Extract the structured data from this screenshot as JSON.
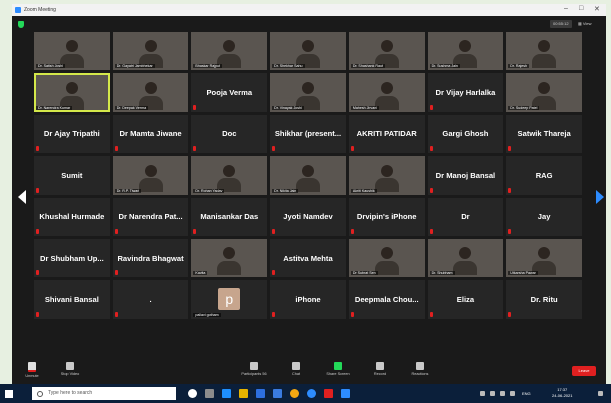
{
  "window": {
    "title": "Zoom Meeting",
    "minimize": "–",
    "maximize": "□",
    "close": "✕"
  },
  "header": {
    "elapsed": "00:55:12",
    "view_label": "View"
  },
  "tiles": [
    {
      "kind": "video",
      "name": "Dr. Satish Joshi"
    },
    {
      "kind": "video",
      "name": "Dr. Gayatri Jambhekar"
    },
    {
      "kind": "video",
      "name": "Bhaskar Rajput"
    },
    {
      "kind": "video",
      "name": "Dr. Shekhar Sahu"
    },
    {
      "kind": "video",
      "name": "Dr. Shashank Raut"
    },
    {
      "kind": "video",
      "name": "Dr. Sushma Jain"
    },
    {
      "kind": "video",
      "name": "Dr. Rajesh"
    },
    {
      "kind": "video",
      "name": "Dr. Narendra Kumar",
      "active": true
    },
    {
      "kind": "video",
      "name": "Dr. Deepak Verma"
    },
    {
      "kind": "text",
      "name": "Pooja Verma"
    },
    {
      "kind": "video",
      "name": "Dr. Vinayak Joshi"
    },
    {
      "kind": "video",
      "name": "Mahesh Jirvani"
    },
    {
      "kind": "text",
      "name": "Dr Vijay Harlalka"
    },
    {
      "kind": "video",
      "name": "Dr. Sudeep Patel"
    },
    {
      "kind": "text",
      "name": "Dr Ajay Tripathi"
    },
    {
      "kind": "text",
      "name": "Dr Mamta Jiwane"
    },
    {
      "kind": "text",
      "name": "Doc"
    },
    {
      "kind": "text",
      "name": "Shikhar (present..."
    },
    {
      "kind": "text",
      "name": "AKRITI PATIDAR"
    },
    {
      "kind": "text",
      "name": "Gargi Ghosh"
    },
    {
      "kind": "text",
      "name": "Satwik Thareja"
    },
    {
      "kind": "text",
      "name": "Sumit"
    },
    {
      "kind": "video",
      "name": "Dr. R.P. Tiwari"
    },
    {
      "kind": "video",
      "name": "Dr. Rohan Yadav"
    },
    {
      "kind": "video",
      "name": "Dr. Nikita Jain"
    },
    {
      "kind": "video",
      "name": "Akriti Kaushik"
    },
    {
      "kind": "text",
      "name": "Dr Manoj Bansal"
    },
    {
      "kind": "text",
      "name": "RAG"
    },
    {
      "kind": "text",
      "name": "Khushal Hurmade"
    },
    {
      "kind": "text",
      "name": "Dr Narendra Pat..."
    },
    {
      "kind": "text",
      "name": "Manisankar Das"
    },
    {
      "kind": "text",
      "name": "Jyoti Namdev"
    },
    {
      "kind": "text",
      "name": "Drvipin's iPhone"
    },
    {
      "kind": "text",
      "name": "Dr"
    },
    {
      "kind": "text",
      "name": "Jay"
    },
    {
      "kind": "text",
      "name": "Dr Shubham Up..."
    },
    {
      "kind": "text",
      "name": "Ravindra Bhagwat"
    },
    {
      "kind": "video",
      "name": "Kavita"
    },
    {
      "kind": "text",
      "name": "Astitva Mehta"
    },
    {
      "kind": "video",
      "name": "Dr Subrat Sen"
    },
    {
      "kind": "video",
      "name": "Dr. Shubham"
    },
    {
      "kind": "video",
      "name": "Utkarsha Pawar"
    },
    {
      "kind": "text",
      "name": "Shivani Bansal"
    },
    {
      "kind": "text",
      "name": "."
    },
    {
      "kind": "avatar",
      "name": "pallavi gotham",
      "letter": "p"
    },
    {
      "kind": "text",
      "name": "iPhone"
    },
    {
      "kind": "text",
      "name": "Deepmala Chou..."
    },
    {
      "kind": "text",
      "name": "Eliza"
    },
    {
      "kind": "text",
      "name": "Dr. Ritu"
    }
  ],
  "toolbar": {
    "unmute": "Unmute",
    "stop_video": "Stop Video",
    "participants": "Participants",
    "participants_count": "56",
    "chat": "Chat",
    "share_screen": "Share Screen",
    "record": "Record",
    "reactions": "Reactions",
    "leave": "Leave"
  },
  "taskbar": {
    "search_placeholder": "Type here to search",
    "time": "17:37",
    "date": "24-06-2021",
    "language": "ENG"
  },
  "colors": {
    "accent": "#2d8cff",
    "leave": "#e02020",
    "active_speaker": "#d4e84a",
    "share": "#23d959"
  }
}
